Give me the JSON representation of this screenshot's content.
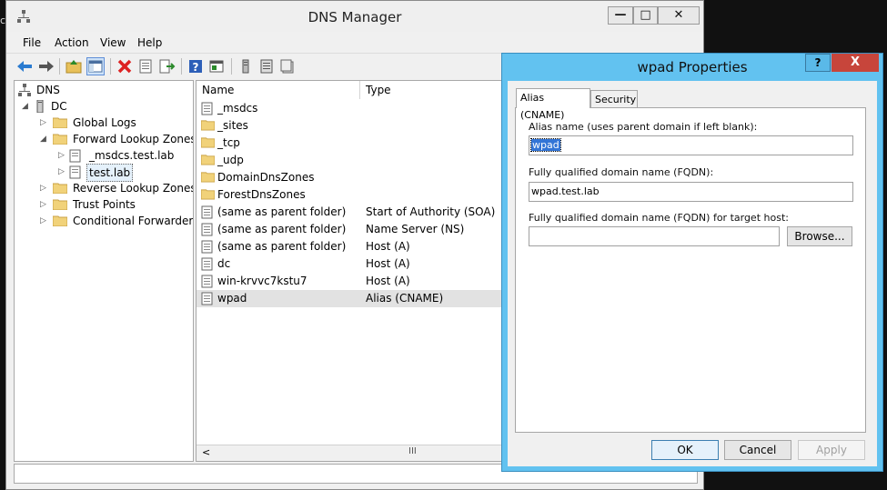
{
  "window": {
    "title": "DNS Manager",
    "desk_text": "cl",
    "caption": {
      "minimize": "—",
      "maximize": "□",
      "close": "✕"
    }
  },
  "menu": [
    "File",
    "Action",
    "View",
    "Help"
  ],
  "toolbar": {
    "buttons": [
      "back-icon",
      "forward-icon",
      "up-folder-icon",
      "show-tree-icon",
      "delete-icon",
      "properties-icon",
      "export-icon",
      "help-icon",
      "console-icon",
      "server-icon",
      "list-icon",
      "zone-icon"
    ]
  },
  "tree": {
    "root": "DNS",
    "server": "DC",
    "nodes": [
      "Global Logs",
      "Forward Lookup Zones",
      "_msdcs.test.lab",
      "test.lab",
      "Reverse Lookup Zones",
      "Trust Points",
      "Conditional Forwarders"
    ],
    "selected": "test.lab"
  },
  "list": {
    "columns": [
      "Name",
      "Type"
    ],
    "rows": [
      {
        "name": "_msdcs",
        "type": ""
      },
      {
        "name": "_sites",
        "type": ""
      },
      {
        "name": "_tcp",
        "type": ""
      },
      {
        "name": "_udp",
        "type": ""
      },
      {
        "name": "DomainDnsZones",
        "type": ""
      },
      {
        "name": "ForestDnsZones",
        "type": ""
      },
      {
        "name": "(same as parent folder)",
        "type": "Start of Authority (SOA)"
      },
      {
        "name": "(same as parent folder)",
        "type": "Name Server (NS)"
      },
      {
        "name": "(same as parent folder)",
        "type": "Host (A)"
      },
      {
        "name": "dc",
        "type": "Host (A)"
      },
      {
        "name": "win-krvvc7kstu7",
        "type": "Host (A)"
      },
      {
        "name": "wpad",
        "type": "Alias (CNAME)"
      }
    ],
    "scroll_left": "<",
    "scroll_thumb": "III"
  },
  "dialog": {
    "title": "wpad Properties",
    "help": "?",
    "close": "X",
    "tabs": [
      "Alias (CNAME)",
      "Security"
    ],
    "alias_label": "Alias name (uses parent domain if left blank):",
    "alias_value": "wpad",
    "fqdn_label": "Fully qualified domain name (FQDN):",
    "fqdn_value": "wpad.test.lab",
    "target_label": "Fully qualified domain name (FQDN) for target host:",
    "target_value": "",
    "browse": "Browse...",
    "ok": "OK",
    "cancel": "Cancel",
    "apply": "Apply"
  }
}
